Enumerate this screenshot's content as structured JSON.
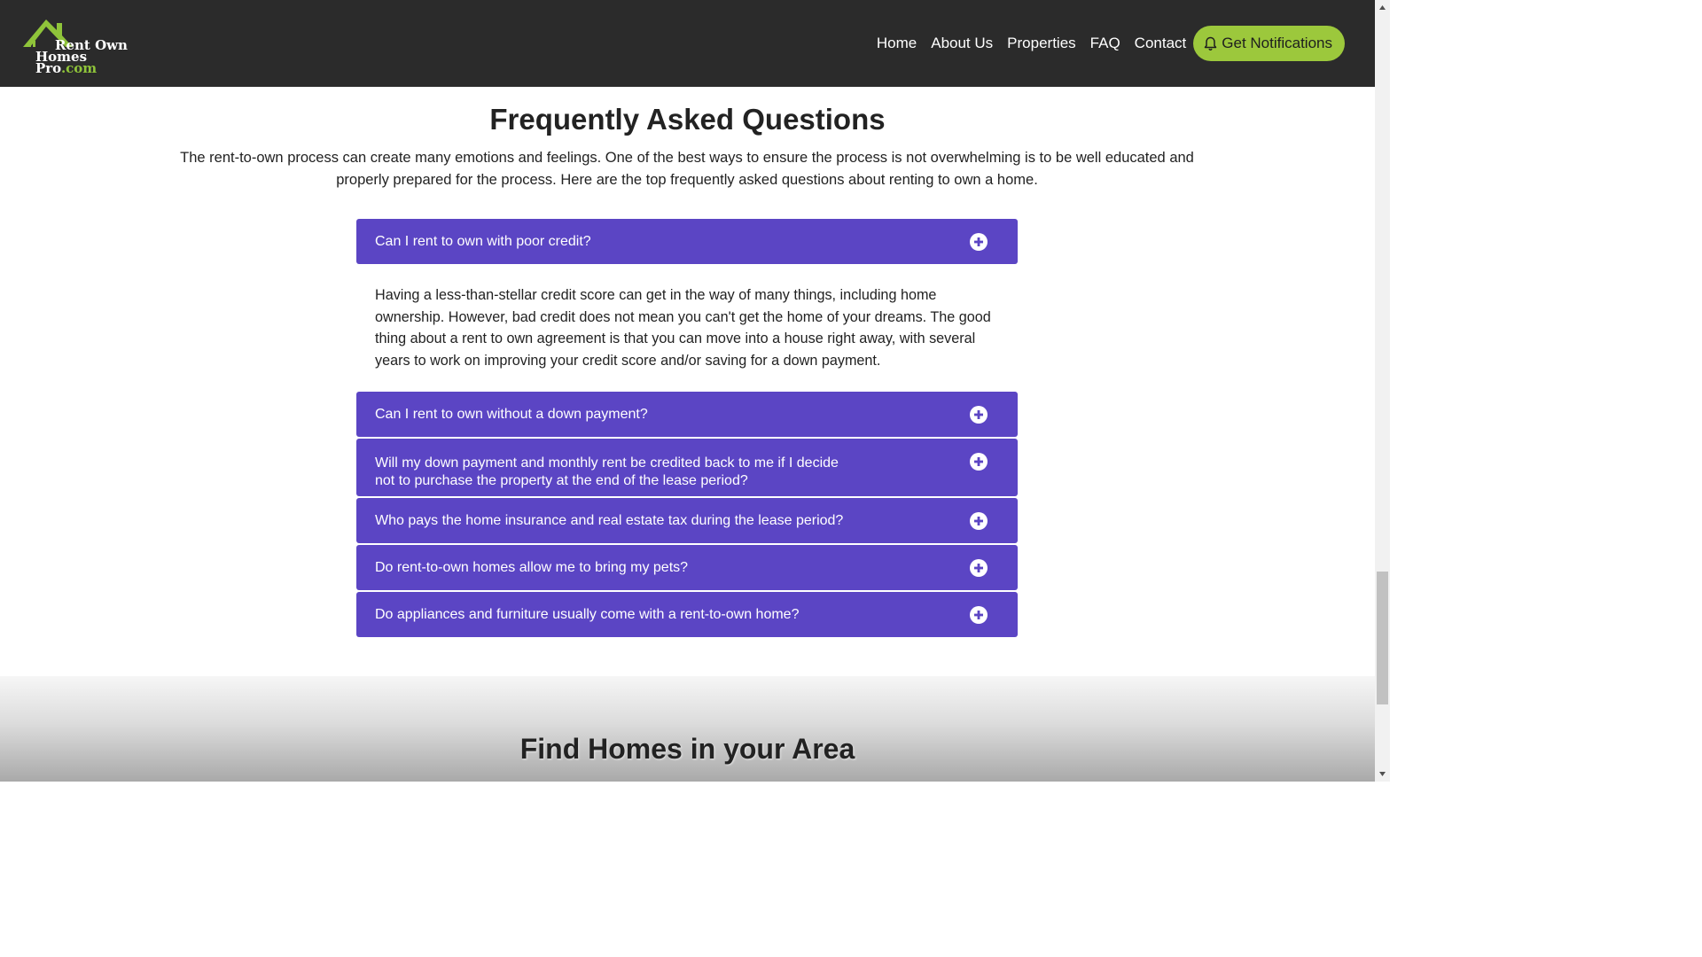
{
  "logo": {
    "line1": "Rent Own",
    "line2_main": "Homes Pro",
    "line2_suffix": ".com"
  },
  "nav": {
    "items": [
      "Home",
      "About Us",
      "Properties",
      "FAQ",
      "Contact"
    ],
    "notify_label": "Get Notifications"
  },
  "faq": {
    "title": "Frequently Asked Questions",
    "intro": "The rent-to-own process can create many emotions and feelings. One of the best ways to ensure the process is not overwhelming is to be well educated and properly prepared for the process. Here are the top frequently asked questions about renting to own a home.",
    "items": [
      {
        "question": "Can I rent to own with poor credit?",
        "answer": "Having a less-than-stellar credit score can get in the way of many things, including home ownership. However, bad credit does not mean you can't get the home of your dreams. The good thing about a rent to own agreement is that you can move into a house right away, with several years to work on improving your credit score and/or saving for a down payment."
      },
      {
        "question": "Can I rent to own without a down payment?"
      },
      {
        "question": "Will my down payment and monthly rent be credited back to me if I decide not to purchase the property at the end of the lease period?"
      },
      {
        "question": "Who pays the home insurance and real estate tax during the lease period?"
      },
      {
        "question": "Do rent-to-own homes allow me to bring my pets?"
      },
      {
        "question": "Do appliances and furniture usually come with a rent-to-own home?"
      }
    ]
  },
  "find": {
    "title": "Find Homes in your Area"
  },
  "colors": {
    "accent_purple": "#5b45c4",
    "brand_green": "#9cc83c",
    "header_bg": "#2b2b2b"
  }
}
